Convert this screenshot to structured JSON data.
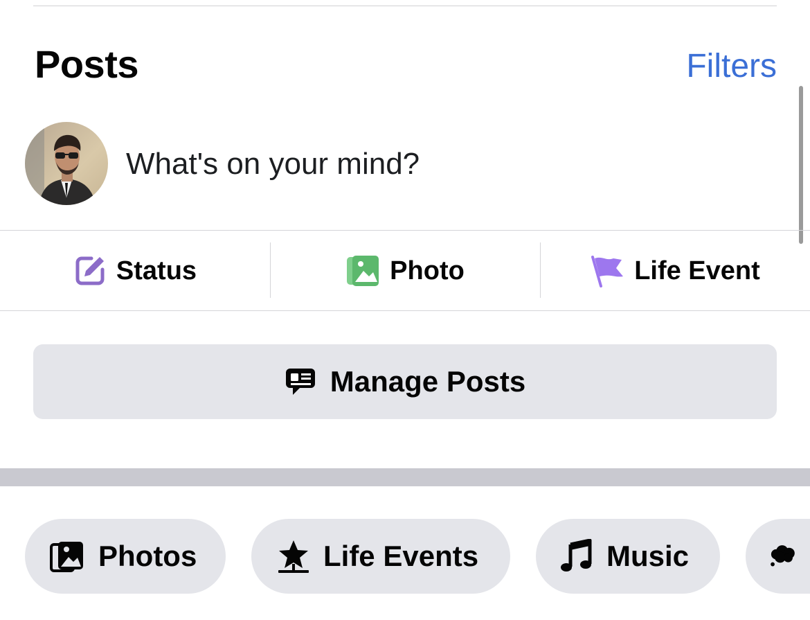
{
  "header": {
    "title": "Posts",
    "filters_label": "Filters"
  },
  "composer": {
    "prompt": "What's on your mind?"
  },
  "actions": [
    {
      "label": "Status",
      "icon": "edit-icon",
      "color": "#8c6cc8"
    },
    {
      "label": "Photo",
      "icon": "photo-icon",
      "color": "#5cb86c"
    },
    {
      "label": "Life Event",
      "icon": "flag-icon",
      "color": "#9d77ee"
    }
  ],
  "manage": {
    "label": "Manage Posts",
    "icon": "manage-posts-icon"
  },
  "chips": [
    {
      "label": "Photos",
      "icon": "photos-icon"
    },
    {
      "label": "Life Events",
      "icon": "star-icon"
    },
    {
      "label": "Music",
      "icon": "music-note-icon"
    },
    {
      "label": "",
      "icon": "thought-bubble-icon"
    }
  ],
  "colors": {
    "link": "#3b6fd6",
    "chip_bg": "#e4e5ea",
    "separator": "#c9c9d0"
  }
}
